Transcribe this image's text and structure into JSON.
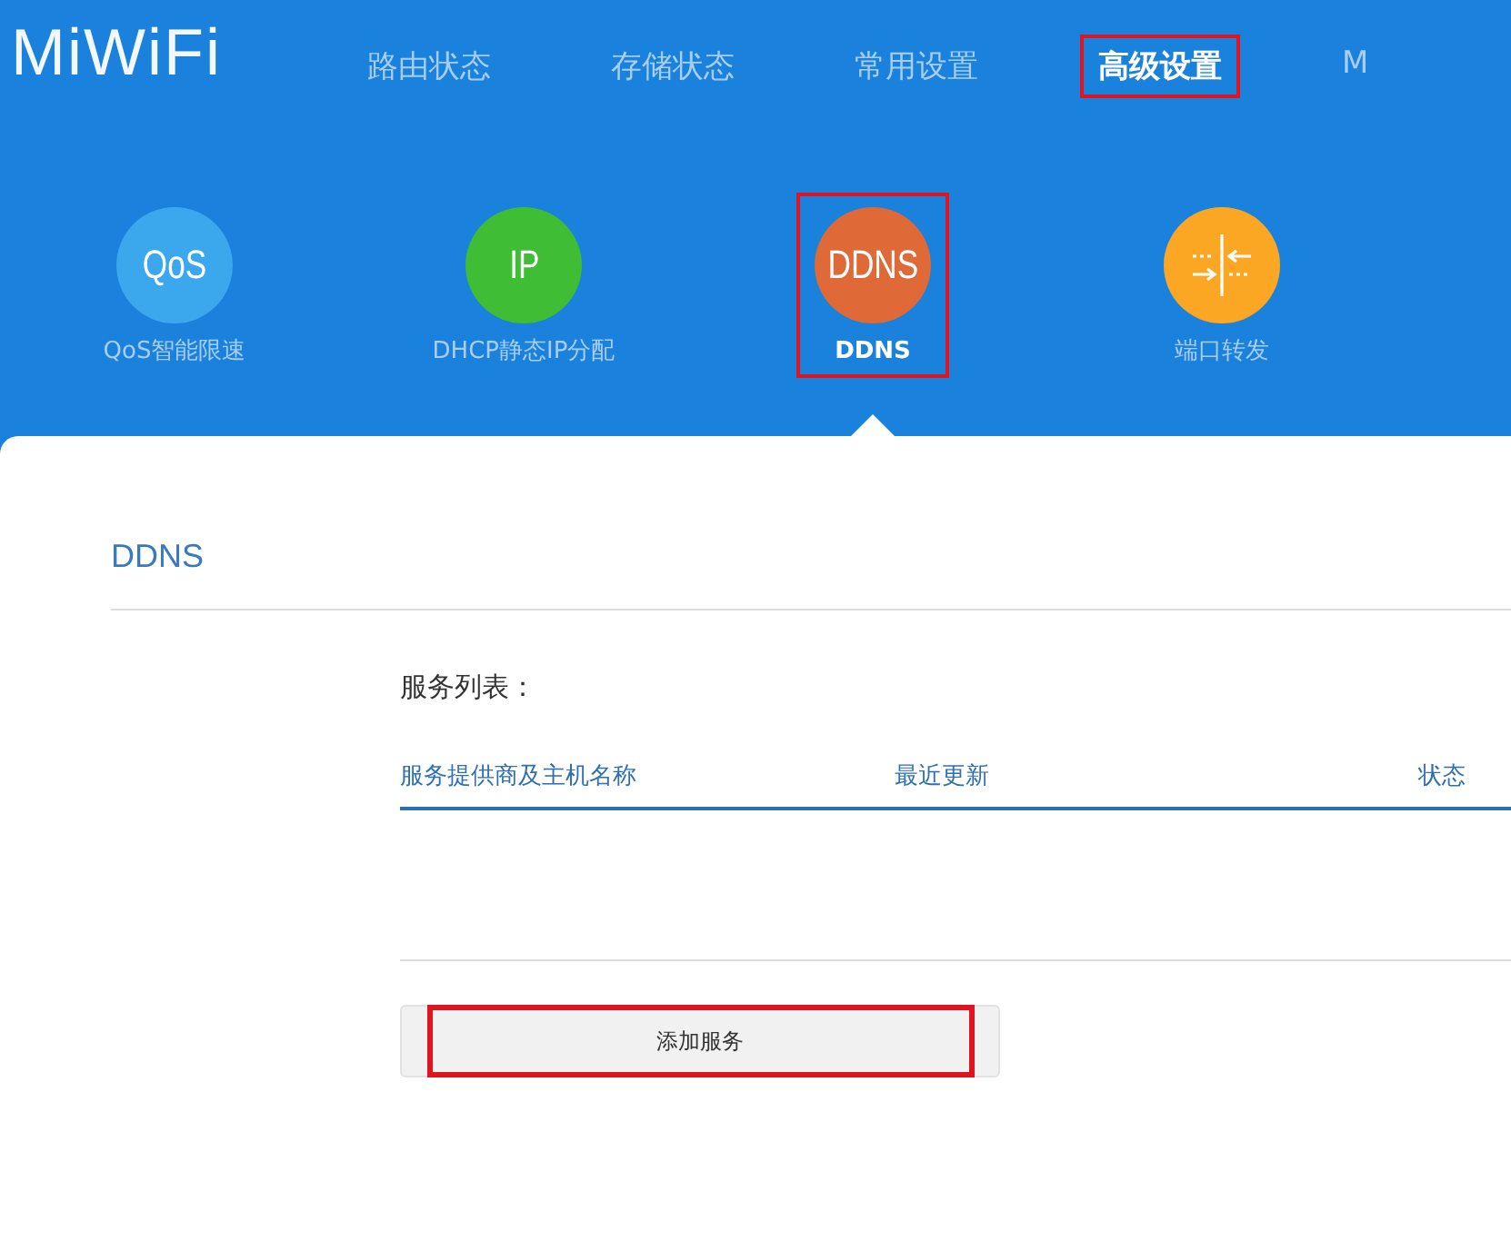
{
  "logo": "MiWiFi",
  "nav": [
    {
      "label": "路由状态",
      "selected": false,
      "highlighted": false
    },
    {
      "label": "存储状态",
      "selected": false,
      "highlighted": false
    },
    {
      "label": "常用设置",
      "selected": false,
      "highlighted": false
    },
    {
      "label": "高级设置",
      "selected": true,
      "highlighted": true
    },
    {
      "label": "M",
      "selected": false,
      "highlighted": false
    }
  ],
  "features": [
    {
      "kind": "text",
      "icon_text": "QoS",
      "label": "QoS智能限速",
      "color": "#3ba8ee",
      "selected": false,
      "highlighted": false
    },
    {
      "kind": "text",
      "icon_text": "IP",
      "label": "DHCP静态IP分配",
      "color": "#3fbd35",
      "selected": false,
      "highlighted": false
    },
    {
      "kind": "text",
      "icon_text": "DDNS",
      "label": "DDNS",
      "color": "#df6a37",
      "selected": true,
      "highlighted": true
    },
    {
      "kind": "ports",
      "label": "端口转发",
      "color": "#fba724",
      "selected": false,
      "highlighted": false
    }
  ],
  "section_title": "DDNS",
  "list_label": "服务列表：",
  "table": {
    "columns": [
      "服务提供商及主机名称",
      "最近更新",
      "状态"
    ]
  },
  "add_button": {
    "label": "添加服务",
    "highlighted": true
  }
}
